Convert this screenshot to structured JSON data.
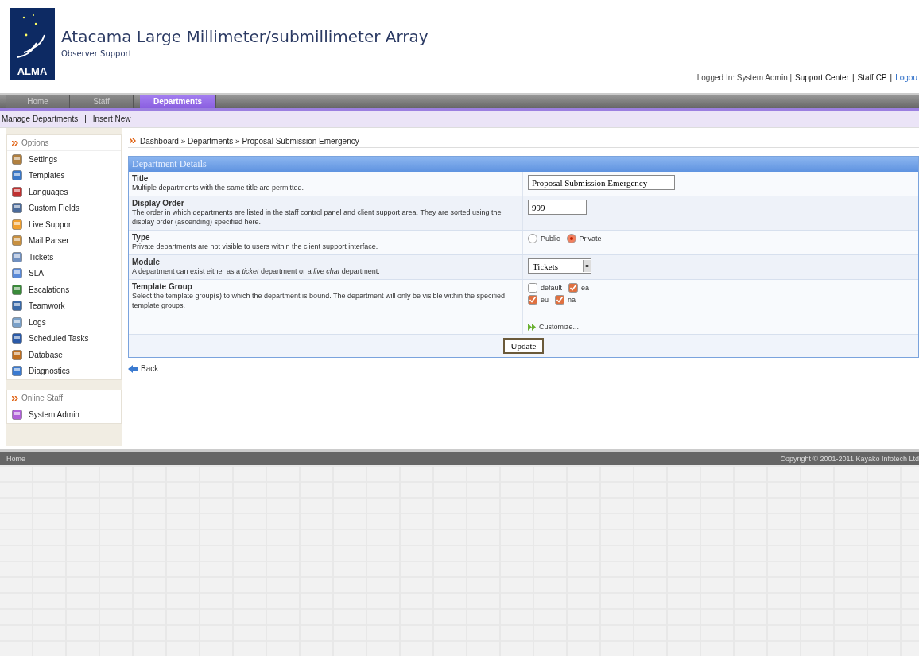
{
  "header": {
    "logo_text": "ALMA",
    "title": "Atacama Large Millimeter/submillimeter Array",
    "subtitle": "Observer Support"
  },
  "separator": "|",
  "user_bar": {
    "prefix": "Logged In: System Admin |",
    "links": [
      {
        "label": "Support Center",
        "kind": "plain"
      },
      {
        "label": "Staff CP",
        "kind": "plain"
      },
      {
        "label": "Logou",
        "kind": "link"
      }
    ]
  },
  "tabs": [
    {
      "label": "Home",
      "selected": false
    },
    {
      "label": "Staff",
      "selected": false
    },
    {
      "label": "Departments",
      "selected": true
    }
  ],
  "subnav": [
    "Manage Departments",
    "Insert New"
  ],
  "sidebar": {
    "options_title": "Options",
    "items": [
      "Settings",
      "Templates",
      "Languages",
      "Custom Fields",
      "Live Support",
      "Mail Parser",
      "Tickets",
      "SLA",
      "Escalations",
      "Teamwork",
      "Logs",
      "Scheduled Tasks",
      "Database",
      "Diagnostics"
    ],
    "staff_title": "Online Staff",
    "staff": [
      "System Admin"
    ]
  },
  "breadcrumb": "Dashboard » Departments » Proposal Submission Emergency",
  "panel": {
    "title": "Department Details",
    "rows": [
      {
        "kind": "text",
        "label": "Title",
        "description": "Multiple departments with the same title are permitted.",
        "value": "Proposal Submission Emergency"
      },
      {
        "kind": "number",
        "label": "Display Order",
        "description": "The order in which departments are listed in the staff control panel and client support area. They are sorted using the display order (ascending) specified here.",
        "value": "999"
      },
      {
        "kind": "radio",
        "label": "Type",
        "description": "Private departments are not visible to users within the client support interface.",
        "options": [
          {
            "label": "Public",
            "selected": false
          },
          {
            "label": "Private",
            "selected": true
          }
        ]
      },
      {
        "kind": "select",
        "label": "Module",
        "description": "A department can exist either as a *ticket* department or a *live chat* department.",
        "value": "Tickets"
      },
      {
        "kind": "checks",
        "label": "Template Group",
        "description": "Select the template group(s) to which the department is bound. The department will only be visible within the specified template groups.",
        "options": [
          {
            "label": "default",
            "checked": false
          },
          {
            "label": "ea",
            "checked": true
          },
          {
            "label": "eu",
            "checked": true
          },
          {
            "label": "na",
            "checked": true
          }
        ],
        "link": "Customize..."
      }
    ],
    "button": "Update"
  },
  "back": "Back",
  "footer": {
    "left": "Home",
    "right": "Copyright © 2001-2011 Kayako Infotech Ltd"
  }
}
